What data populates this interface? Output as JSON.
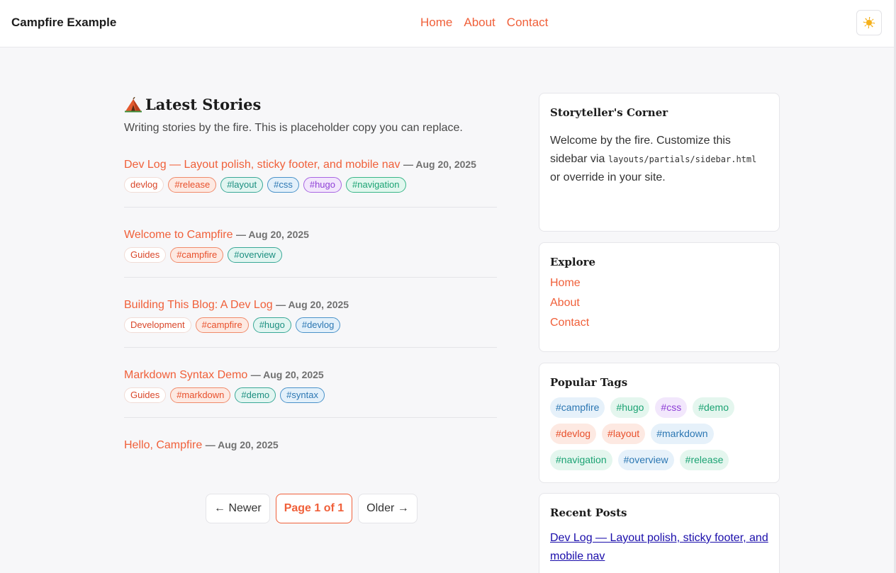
{
  "header": {
    "brand": "Campfire Example",
    "nav": [
      "Home",
      "About",
      "Contact"
    ],
    "theme_icon": "sun-icon"
  },
  "main": {
    "title": "Latest Stories",
    "title_icon": "tent-icon",
    "intro": "Writing stories by the fire. This is placeholder copy you can replace.",
    "posts": [
      {
        "title": "Dev Log — Layout polish, sticky footer, and mobile nav",
        "date": "— Aug 20, 2025",
        "category": "devlog",
        "tags": [
          "#release",
          "#layout",
          "#css",
          "#hugo",
          "#navigation"
        ]
      },
      {
        "title": "Welcome to Campfire",
        "date": "— Aug 20, 2025",
        "category": "Guides",
        "tags": [
          "#campfire",
          "#overview"
        ]
      },
      {
        "title": "Building This Blog: A Dev Log",
        "date": "— Aug 20, 2025",
        "category": "Development",
        "tags": [
          "#campfire",
          "#hugo",
          "#devlog"
        ]
      },
      {
        "title": "Markdown Syntax Demo",
        "date": "— Aug 20, 2025",
        "category": "Guides",
        "tags": [
          "#markdown",
          "#demo",
          "#syntax"
        ]
      },
      {
        "title": "Hello, Campfire",
        "date": "— Aug 20, 2025"
      }
    ],
    "pager": {
      "newer": "← Newer",
      "current": "Page 1 of 1",
      "older": "Older →"
    }
  },
  "sidebar": {
    "storyteller": {
      "title": "Storyteller's Corner",
      "text_before": "Welcome by the fire. Customize this sidebar via ",
      "code": "layouts/partials/sidebar.html",
      "text_after": " or override in your site."
    },
    "explore": {
      "title": "Explore",
      "links": [
        "Home",
        "About",
        "Contact"
      ]
    },
    "popular_tags": {
      "title": "Popular Tags",
      "tags": [
        "#campfire",
        "#hugo",
        "#css",
        "#demo",
        "#devlog",
        "#layout",
        "#markdown",
        "#navigation",
        "#overview",
        "#release"
      ]
    },
    "recent": {
      "title": "Recent Posts",
      "links": [
        "Dev Log — Layout polish, sticky footer, and mobile nav"
      ]
    }
  },
  "colors": {
    "accent": "#f0603a",
    "link_visited": "#1a0dab"
  }
}
